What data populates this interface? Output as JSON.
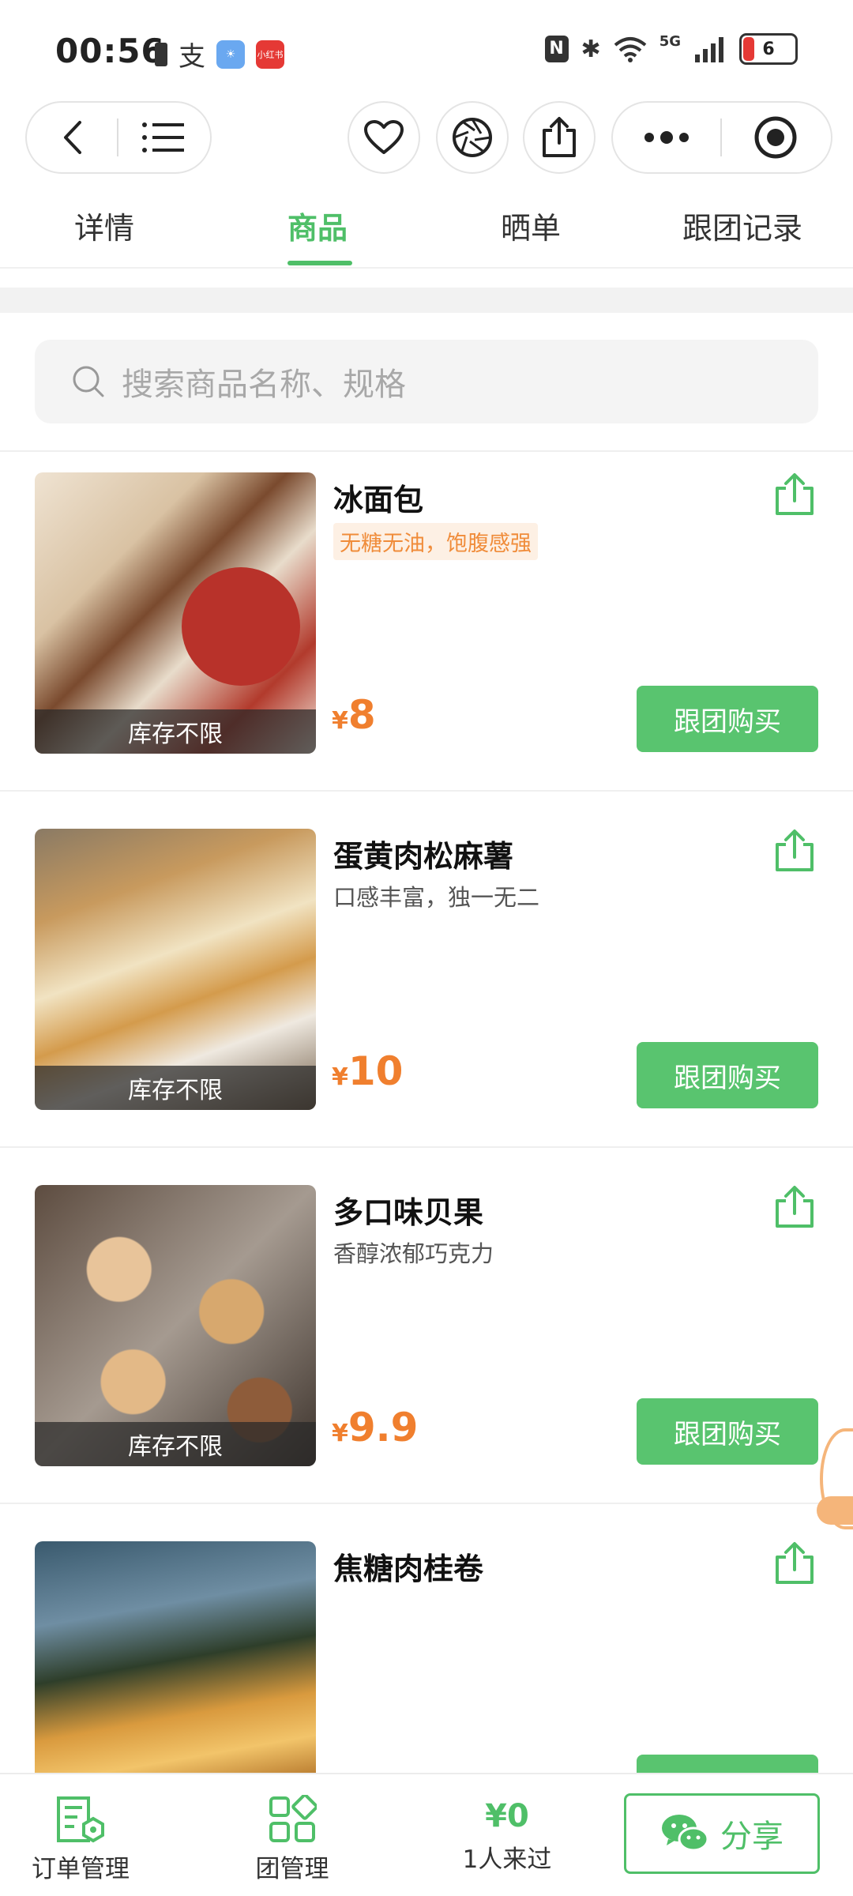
{
  "status_bar": {
    "time": "00:56",
    "battery_level": "6",
    "network": "5G"
  },
  "tabs": [
    {
      "label": "详情",
      "active": false
    },
    {
      "label": "商品",
      "active": true
    },
    {
      "label": "晒单",
      "active": false
    },
    {
      "label": "跟团记录",
      "active": false
    }
  ],
  "search": {
    "placeholder": "搜索商品名称、规格"
  },
  "products": [
    {
      "name": "冰面包",
      "tag": "无糖无油，饱腹感强",
      "currency": "¥",
      "price": "8",
      "stock": "库存不限",
      "buy_label": "跟团购买"
    },
    {
      "name": "蛋黄肉松麻薯",
      "desc": "口感丰富，独一无二",
      "currency": "¥",
      "price": "10",
      "stock": "库存不限",
      "buy_label": "跟团购买"
    },
    {
      "name": "多口味贝果",
      "desc": "香醇浓郁巧克力",
      "currency": "¥",
      "price": "9.9",
      "stock": "库存不限",
      "buy_label": "跟团购买"
    },
    {
      "name": "焦糖肉桂卷"
    }
  ],
  "bottom_bar": {
    "orders_label": "订单管理",
    "group_label": "团管理",
    "amount": "¥0",
    "visitors_label": "1人来过",
    "share_label": "分享"
  },
  "colors": {
    "accent": "#4fbf68",
    "price": "#f07f2e"
  }
}
